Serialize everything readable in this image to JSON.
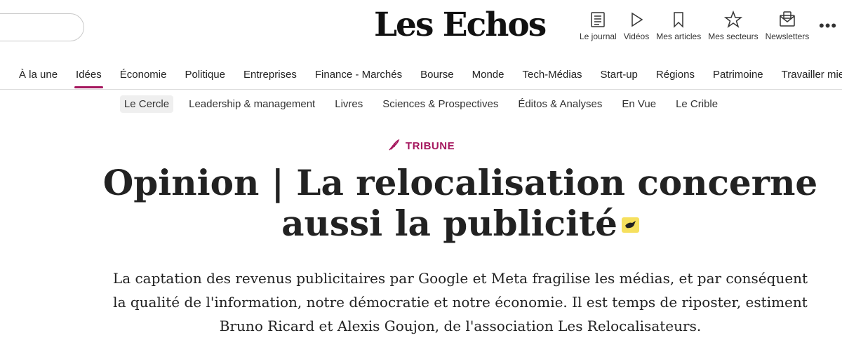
{
  "header": {
    "logo": "Les Echos",
    "tools": [
      {
        "label": "Le journal",
        "icon": "newspaper-icon"
      },
      {
        "label": "Vidéos",
        "icon": "play-icon"
      },
      {
        "label": "Mes articles",
        "icon": "bookmark-icon"
      },
      {
        "label": "Mes secteurs",
        "icon": "star-icon"
      },
      {
        "label": "Newsletters",
        "icon": "envelope-icon"
      }
    ],
    "more": "•••"
  },
  "nav": {
    "items": [
      "À la une",
      "Idées",
      "Économie",
      "Politique",
      "Entreprises",
      "Finance - Marchés",
      "Bourse",
      "Monde",
      "Tech-Médias",
      "Start-up",
      "Régions",
      "Patrimoine",
      "Travailler mieux"
    ],
    "active": "Idées"
  },
  "subnav": {
    "items": [
      "Le Cercle",
      "Leadership & management",
      "Livres",
      "Sciences & Prospectives",
      "Éditos & Analyses",
      "En Vue",
      "Le Crible"
    ],
    "active": "Le Cercle"
  },
  "article": {
    "kicker": "TRIBUNE",
    "kicker_icon": "quill-icon",
    "title": "Opinion | La relocalisation concerne aussi la publicité",
    "lede": "La captation des revenus publicitaires par Google et Meta fragilise les médias, et par conséquent la qualité de l'information, notre démocratie et notre économie. Il est temps de riposter, estiment Bruno Ricard et Alexis Goujon, de l'association Les Relocalisateurs."
  },
  "colors": {
    "accent": "#a5175e",
    "badge": "#f6e05e",
    "text": "#222222"
  }
}
